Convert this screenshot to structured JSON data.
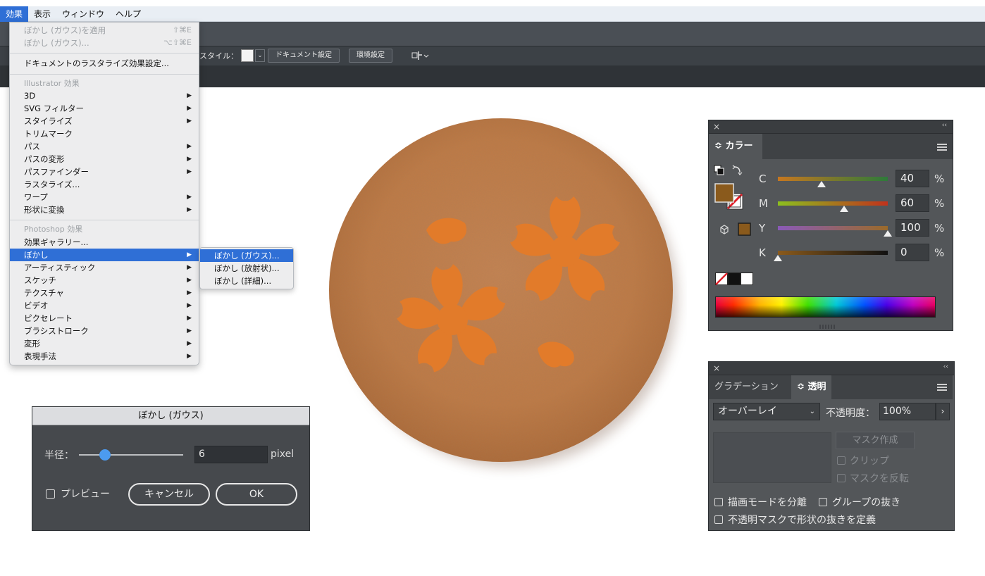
{
  "menubar": {
    "items": [
      "効果",
      "表示",
      "ウィンドウ",
      "ヘルプ"
    ]
  },
  "control_bar": {
    "style_label": "スタイル：",
    "doc_settings": "ドキュメント設定",
    "preferences": "環境設定"
  },
  "effect_menu": {
    "apply_blur": "ぼかし (ガウス)を適用",
    "apply_blur_shortcut": "⇧⌘E",
    "blur_last": "ぼかし (ガウス)...",
    "blur_last_shortcut": "⌥⇧⌘E",
    "raster_settings": "ドキュメントのラスタライズ効果設定...",
    "illustrator_header": "Illustrator 効果",
    "illustrator_items": [
      "3D",
      "SVG フィルター",
      "スタイライズ",
      "トリムマーク",
      "パス",
      "パスの変形",
      "パスファインダー",
      "ラスタライズ...",
      "ワープ",
      "形状に変換"
    ],
    "photoshop_header": "Photoshop 効果",
    "photoshop_items": [
      "効果ギャラリー...",
      "ぼかし",
      "アーティスティック",
      "スケッチ",
      "テクスチャ",
      "ビデオ",
      "ピクセレート",
      "ブラシストローク",
      "変形",
      "表現手法"
    ]
  },
  "blur_submenu": {
    "items": [
      "ぼかし (ガウス)...",
      "ぼかし (放射状)...",
      "ぼかし (詳細)..."
    ]
  },
  "blur_dialog": {
    "title": "ぼかし (ガウス)",
    "radius_label": "半径：",
    "radius_value": "6",
    "unit": "pixel",
    "radius_fraction": 0.25,
    "preview_label": "プレビュー",
    "cancel_label": "キャンセル",
    "ok_label": "OK"
  },
  "color_panel": {
    "close_icon": "×",
    "collapse_icon": "‹‹",
    "tab_label": "カラー",
    "tab_caret": "≎",
    "fill_color": "#8a5a1c",
    "sliders": [
      {
        "label": "C",
        "value": "40",
        "percent": "%"
      },
      {
        "label": "M",
        "value": "60",
        "percent": "%"
      },
      {
        "label": "Y",
        "value": "100",
        "percent": "%"
      },
      {
        "label": "K",
        "value": "0",
        "percent": "%"
      }
    ]
  },
  "transparency_panel": {
    "close_icon": "×",
    "collapse_icon": "‹‹",
    "tab_gradient": "グラデーション",
    "tab_transparency": "透明",
    "tab_caret": "≎",
    "blend_mode": "オーバーレイ",
    "opacity_label": "不透明度：",
    "opacity_value": "100%",
    "opacity_arrow": "›",
    "make_mask": "マスク作成",
    "clip": "クリップ",
    "invert_mask": "マスクを反転",
    "isolate_blending": "描画モードを分離",
    "knockout_group": "グループの抜き",
    "opacity_mask_define": "不透明マスクで形状の抜きを定義"
  },
  "colors": {
    "menu_highlight": "#2f6fd6",
    "dorayaki": "#c07a45",
    "sakura": "#e07b2c"
  }
}
